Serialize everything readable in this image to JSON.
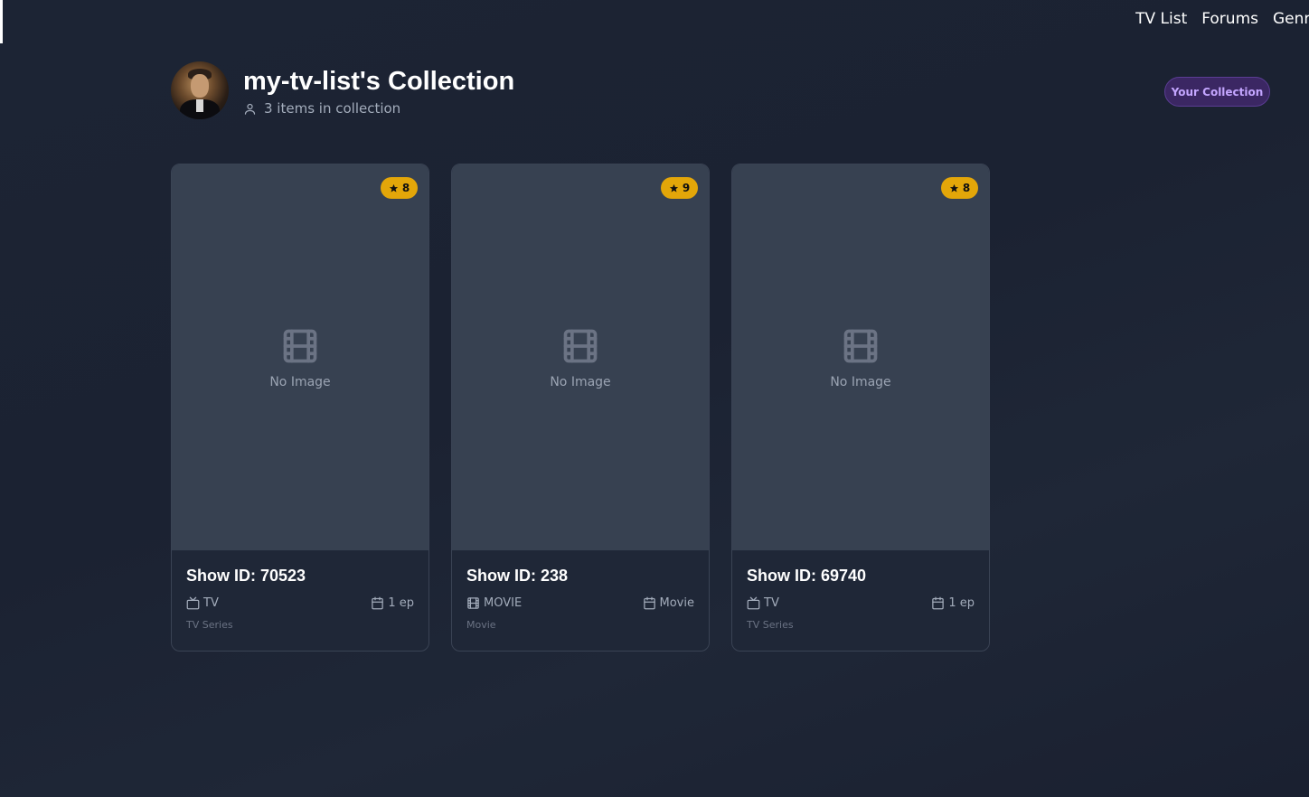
{
  "nav": {
    "items": [
      "TV List",
      "Forums",
      "Genre"
    ]
  },
  "header": {
    "title": "my-tv-list's Collection",
    "count_text": "3 items in collection",
    "badge": "Your Collection"
  },
  "cards": [
    {
      "rating": "8",
      "placeholder": "No Image",
      "title": "Show ID: 70523",
      "type": "TV",
      "type_icon": "tv-icon",
      "episodes": "1 ep",
      "subtype": "TV Series"
    },
    {
      "rating": "9",
      "placeholder": "No Image",
      "title": "Show ID: 238",
      "type": "MOVIE",
      "type_icon": "film-icon",
      "episodes": "Movie",
      "subtype": "Movie"
    },
    {
      "rating": "8",
      "placeholder": "No Image",
      "title": "Show ID: 69740",
      "type": "TV",
      "type_icon": "tv-icon",
      "episodes": "1 ep",
      "subtype": "TV Series"
    }
  ],
  "colors": {
    "background": "#1c2434",
    "card": "#1f2737",
    "poster": "#374151",
    "rating": "#e3a609",
    "badge": "#3b2763",
    "badge_text": "#c4a6ff"
  }
}
